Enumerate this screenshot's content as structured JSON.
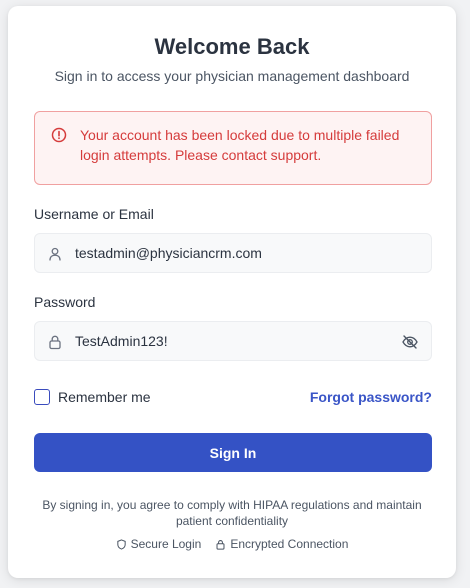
{
  "header": {
    "title": "Welcome Back",
    "subtitle": "Sign in to access your physician management dashboard"
  },
  "alert": {
    "icon": "alert-circle-icon",
    "message": "Your account has been locked due to multiple failed login attempts. Please contact support.",
    "color": "#d53b3b"
  },
  "form": {
    "username": {
      "label": "Username or Email",
      "value": "testadmin@physiciancrm.com",
      "icon": "user-icon"
    },
    "password": {
      "label": "Password",
      "value": "TestAdmin123!",
      "icon": "lock-icon",
      "toggle_icon": "eye-off-icon"
    },
    "remember_label": "Remember me",
    "remember_checked": false,
    "forgot_label": "Forgot password?",
    "submit_label": "Sign In"
  },
  "footer": {
    "notice": "By signing in, you agree to comply with HIPAA regulations and maintain patient confidentiality",
    "badges": [
      {
        "icon": "shield-icon",
        "label": "Secure Login"
      },
      {
        "icon": "lock-icon",
        "label": "Encrypted Connection"
      }
    ]
  },
  "colors": {
    "primary": "#3452c5",
    "link": "#3a55c7",
    "error": "#d53b3b"
  }
}
